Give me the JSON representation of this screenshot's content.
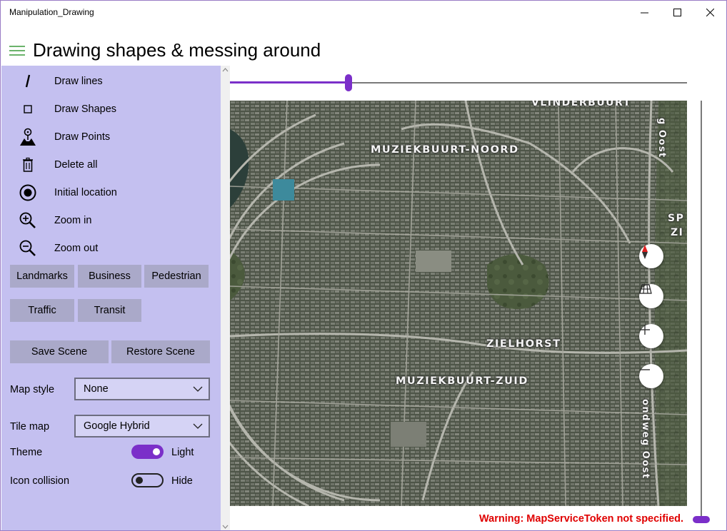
{
  "window": {
    "title": "Manipulation_Drawing"
  },
  "header": {
    "title": "Drawing shapes & messing around"
  },
  "sidebar": {
    "nav_items": [
      {
        "label": "Draw lines",
        "icon": "slash-icon"
      },
      {
        "label": "Draw Shapes",
        "icon": "square-icon"
      },
      {
        "label": "Draw Points",
        "icon": "map-pin-icon"
      },
      {
        "label": "Delete all",
        "icon": "trash-icon"
      },
      {
        "label": "Initial location",
        "icon": "target-icon"
      },
      {
        "label": "Zoom in",
        "icon": "zoom-in-icon"
      },
      {
        "label": "Zoom out",
        "icon": "zoom-out-icon"
      }
    ],
    "layer_buttons": [
      "Landmarks",
      "Business",
      "Pedestrian",
      "Traffic",
      "Transit"
    ],
    "scene_buttons": {
      "save": "Save Scene",
      "restore": "Restore Scene"
    },
    "map_style": {
      "label": "Map style",
      "value": "None"
    },
    "tile_map": {
      "label": "Tile map",
      "value": "Google Hybrid"
    },
    "theme": {
      "label": "Theme",
      "state_text": "Light",
      "on": true
    },
    "icon_collision": {
      "label": "Icon collision",
      "state_text": "Hide",
      "on": false
    }
  },
  "sliders": {
    "horizontal_fraction": 0.26,
    "vertical_fraction": 0.0
  },
  "map": {
    "labels": [
      "VLINDERBUURT",
      "MUZIEKBUURT-NOORD",
      "ZIELHORST",
      "MUZIEKBUURT-ZUID",
      "g Oost",
      "SP",
      "ZI",
      "ondweg Oost"
    ],
    "controls": [
      "compass-icon",
      "tilt-grid-icon",
      "zoom-plus-icon",
      "zoom-minus-icon"
    ]
  },
  "status": {
    "warning": "Warning: MapServiceToken not specified."
  },
  "colors": {
    "accent": "#7b2fc9",
    "sidebar_bg": "#c4c0f0",
    "button_bg": "#aaa9c9",
    "warning": "#e00000"
  }
}
